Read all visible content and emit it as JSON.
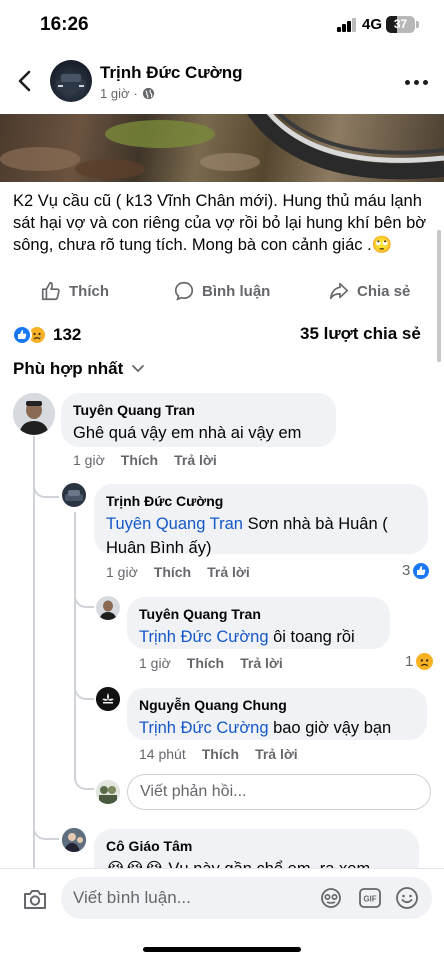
{
  "status_bar": {
    "time": "16:26",
    "network": "4G",
    "battery": "37",
    "battery_level": 0.37
  },
  "header": {
    "author": "Trịnh Đức Cường",
    "time": "1 giờ",
    "privacy_icon": "globe-icon"
  },
  "post": {
    "text": "K2 Vụ cầu cũ ( k13 Vĩnh Chân mới). Hung thủ máu lạnh sát hại vợ và con riêng của vợ rồi bỏ lại hung khí bên bờ sông, chưa rõ tung tích. Mong bà con cảnh giác .🙄"
  },
  "actions": {
    "like": "Thích",
    "comment": "Bình luận",
    "share": "Chia sẻ"
  },
  "stats": {
    "reactions": "132",
    "shares": "35 lượt chia sẻ"
  },
  "sort_label": "Phù hợp nhất",
  "comments": [
    {
      "name": "Tuyên Quang Tran",
      "text": "Ghê quá vậy em nhà ai vậy em",
      "time": "1 giờ",
      "like": "Thích",
      "reply": "Trả lời"
    },
    {
      "name": "Trịnh Đức Cường",
      "mention": "Tuyên Quang Tran",
      "text": " Sơn nhà bà Huân ( Huân Bình ấy)",
      "time": "1 giờ",
      "like": "Thích",
      "reply": "Trả lời",
      "reactions": "3"
    },
    {
      "name": "Tuyên Quang Tran",
      "mention": "Trịnh Đức Cường",
      "text": " ôi toang rồi",
      "time": "1 giờ",
      "like": "Thích",
      "reply": "Trả lời",
      "reactions": "1"
    },
    {
      "name": "Nguyễn Quang Chung",
      "mention": "Trịnh Đức Cường",
      "text": " bao giờ vậy bạn",
      "time": "14 phút",
      "like": "Thích",
      "reply": "Trả lời"
    },
    {
      "name": "Cô Giáo Tâm",
      "text": "😭😭😭 Vụ này gần chổ em, ra xem"
    }
  ],
  "reply_placeholder": "Viết phản hồi...",
  "comment_placeholder": "Viết bình luận...",
  "colors": {
    "accent": "#1877f2",
    "mention": "#1458c8",
    "muted": "#65676b",
    "bubble": "#f0f2f5"
  }
}
